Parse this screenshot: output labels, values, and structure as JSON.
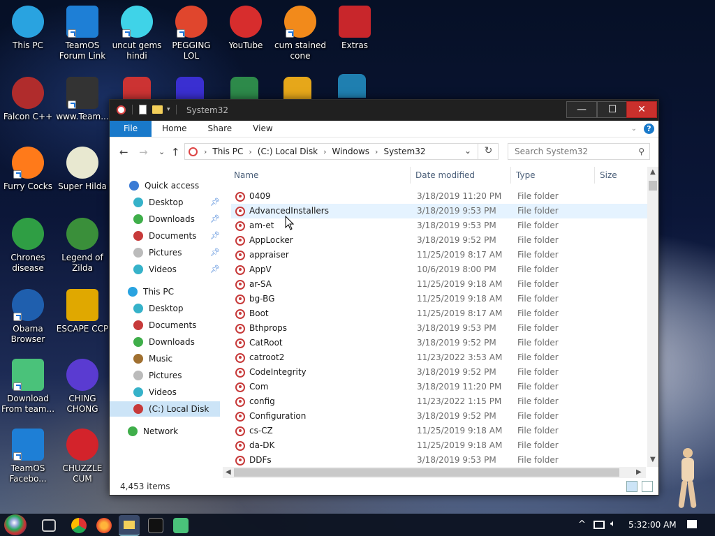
{
  "desktop": {
    "icons": [
      {
        "label": "This PC",
        "icon": "computer-icon",
        "color": "#29a3e0"
      },
      {
        "label": "TeamOS Forum Link",
        "icon": "gear-icon",
        "color": "#1e7fd6"
      },
      {
        "label": "uncut gems hindi",
        "icon": "diamond-icon",
        "color": "#3fd3e8"
      },
      {
        "label": "PEGGING LOL",
        "icon": "p-logo-icon",
        "color": "#e0462d"
      },
      {
        "label": "YouTube",
        "icon": "angry-bird-icon",
        "color": "#d72d2d"
      },
      {
        "label": "cum stained cone",
        "icon": "traffic-cone-icon",
        "color": "#f28a1b"
      },
      {
        "label": "Extras",
        "icon": "extras-icon",
        "color": "#c8262b"
      },
      {
        "label": "Falcon C++",
        "icon": "falcon-icon",
        "color": "#b02c2c"
      },
      {
        "label": "www.Team...",
        "icon": "phone-icon",
        "color": "#333333"
      },
      {
        "label": "Furry Cocks",
        "icon": "firefox-icon",
        "color": "#ff7a1a"
      },
      {
        "label": "Super Hilda",
        "icon": "pixel-character-icon",
        "color": "#e8e8d0"
      },
      {
        "label": "Chrones disease",
        "icon": "chrome-icon",
        "color": "#2f9e44"
      },
      {
        "label": "Legend of Zilda",
        "icon": "pixel-link-icon",
        "color": "#3a8f3a"
      },
      {
        "label": "Obama Browser",
        "icon": "obama-logo-icon",
        "color": "#1f5fae"
      },
      {
        "label": "ESCAPE CCP",
        "icon": "escape-icon",
        "color": "#e0a800"
      },
      {
        "label": "Download From team...",
        "icon": "notepad-icon",
        "color": "#4ac27a"
      },
      {
        "label": "CHING CHONG",
        "icon": "orb-icon",
        "color": "#5a3bd1"
      },
      {
        "label": "TeamOS Facebo...",
        "icon": "gear-icon",
        "color": "#1e7fd6"
      },
      {
        "label": "CHUZZLE CUM",
        "icon": "chuzzle-icon",
        "color": "#d3232b"
      }
    ]
  },
  "window": {
    "title": "System32",
    "minimize": "—",
    "maximize": "☐",
    "close": "✕"
  },
  "ribbon": {
    "tabs": [
      "File",
      "Home",
      "Share",
      "View"
    ],
    "help": "?"
  },
  "nav": {
    "back": "←",
    "forward": "→",
    "recent": "⌄",
    "up": "↑",
    "breadcrumb": [
      "This PC",
      "(C:) Local Disk",
      "Windows",
      "System32"
    ],
    "refresh": "↻",
    "search_placeholder": "Search System32"
  },
  "navpane": {
    "quick_access": "Quick access",
    "quick_items": [
      "Desktop",
      "Downloads",
      "Documents",
      "Pictures",
      "Videos"
    ],
    "this_pc": "This PC",
    "pc_items": [
      "Desktop",
      "Documents",
      "Downloads",
      "Music",
      "Pictures",
      "Videos",
      "(C:) Local Disk"
    ],
    "network": "Network"
  },
  "filelist": {
    "columns": [
      "Name",
      "Date modified",
      "Type",
      "Size"
    ],
    "rows": [
      {
        "name": "0409",
        "date": "3/18/2019 11:20 PM",
        "type": "File folder"
      },
      {
        "name": "AdvancedInstallers",
        "date": "3/18/2019 9:53 PM",
        "type": "File folder"
      },
      {
        "name": "am-et",
        "date": "3/18/2019 9:53 PM",
        "type": "File folder"
      },
      {
        "name": "AppLocker",
        "date": "3/18/2019 9:52 PM",
        "type": "File folder"
      },
      {
        "name": "appraiser",
        "date": "11/25/2019 8:17 AM",
        "type": "File folder"
      },
      {
        "name": "AppV",
        "date": "10/6/2019 8:00 PM",
        "type": "File folder"
      },
      {
        "name": "ar-SA",
        "date": "11/25/2019 9:18 AM",
        "type": "File folder"
      },
      {
        "name": "bg-BG",
        "date": "11/25/2019 9:18 AM",
        "type": "File folder"
      },
      {
        "name": "Boot",
        "date": "11/25/2019 8:17 AM",
        "type": "File folder"
      },
      {
        "name": "Bthprops",
        "date": "3/18/2019 9:53 PM",
        "type": "File folder"
      },
      {
        "name": "CatRoot",
        "date": "3/18/2019 9:52 PM",
        "type": "File folder"
      },
      {
        "name": "catroot2",
        "date": "11/23/2022 3:53 AM",
        "type": "File folder"
      },
      {
        "name": "CodeIntegrity",
        "date": "3/18/2019 9:52 PM",
        "type": "File folder"
      },
      {
        "name": "Com",
        "date": "3/18/2019 11:20 PM",
        "type": "File folder"
      },
      {
        "name": "config",
        "date": "11/23/2022 1:15 PM",
        "type": "File folder"
      },
      {
        "name": "Configuration",
        "date": "3/18/2019 9:52 PM",
        "type": "File folder"
      },
      {
        "name": "cs-CZ",
        "date": "11/25/2019 9:18 AM",
        "type": "File folder"
      },
      {
        "name": "da-DK",
        "date": "11/25/2019 9:18 AM",
        "type": "File folder"
      },
      {
        "name": "DDFs",
        "date": "3/18/2019 9:53 PM",
        "type": "File folder"
      }
    ],
    "hover_index": 1
  },
  "status": {
    "item_count": "4,453 items"
  },
  "taskbar": {
    "clock": "5:32:00 AM",
    "tray_chevron": "^"
  },
  "colors": {
    "accent": "#1979ca",
    "selection": "#cce4f7",
    "hover": "#e5f3ff"
  }
}
